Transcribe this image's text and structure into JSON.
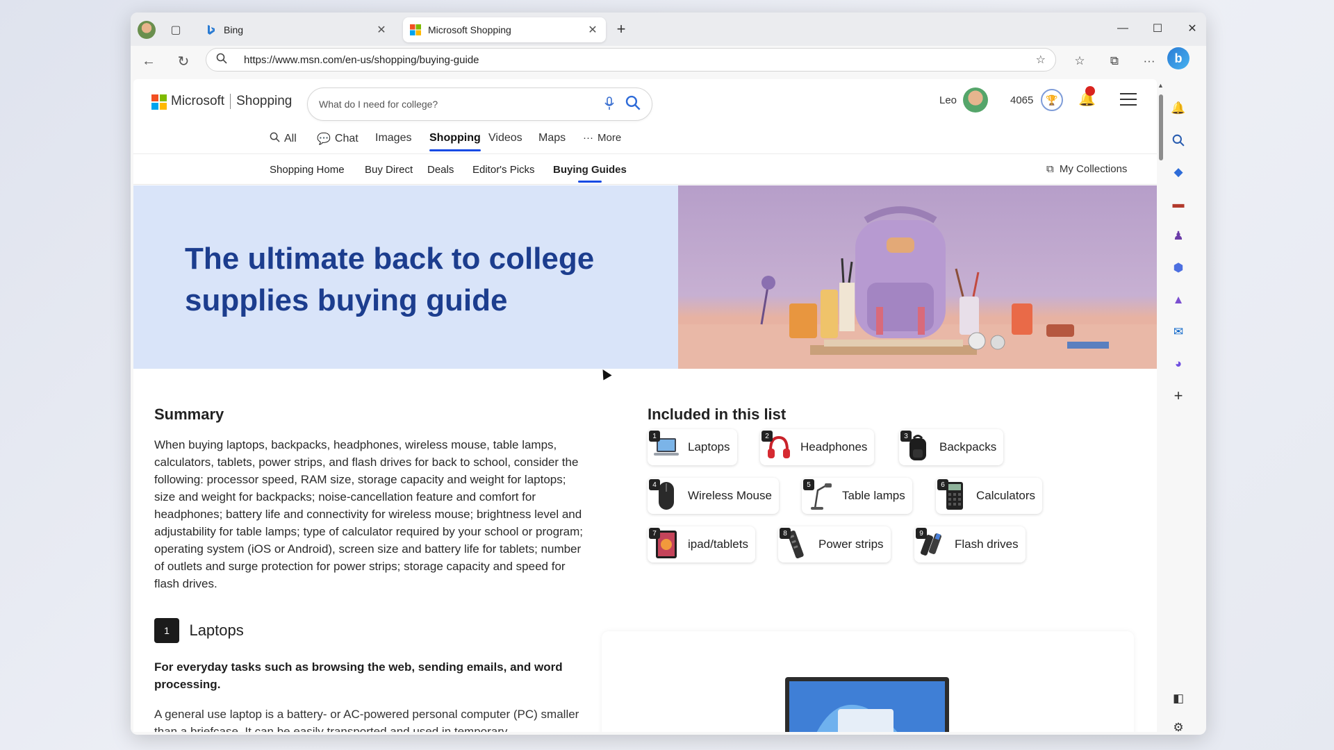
{
  "browser": {
    "tabs": [
      {
        "title": "Bing",
        "close": "✕"
      },
      {
        "title": "Microsoft Shopping",
        "close": "✕"
      }
    ],
    "new_tab": "+",
    "url": "https://www.msn.com/en-us/shopping/buying-guide",
    "window_controls": {
      "minimize": "—",
      "maximize": "☐",
      "close": "✕"
    },
    "copilot_label": "b"
  },
  "site": {
    "brand": "Microsoft",
    "section": "Shopping",
    "search_placeholder": "What do I need for college?",
    "user_name": "Leo",
    "points": "4065"
  },
  "scopes": [
    {
      "label": "All",
      "icon": "search-icon"
    },
    {
      "label": "Chat",
      "icon": "chat-icon"
    },
    {
      "label": "Images"
    },
    {
      "label": "Shopping",
      "active": true
    },
    {
      "label": "Videos"
    },
    {
      "label": "Maps"
    },
    {
      "label": "More",
      "icon": "more-icon"
    }
  ],
  "subnav": {
    "items": [
      "Shopping Home",
      "Buy Direct",
      "Deals",
      "Editor's Picks",
      "Buying Guides"
    ],
    "active": "Buying Guides",
    "collections": "My Collections"
  },
  "hero": {
    "title": "The ultimate back to college supplies buying guide"
  },
  "summary": {
    "heading": "Summary",
    "text": "When buying laptops, backpacks, headphones, wireless mouse, table lamps, calculators, tablets, power strips, and flash drives for back to school, consider the following: processor speed, RAM size, storage capacity and weight for laptops; size and weight for backpacks; noise-cancellation feature and comfort for headphones; battery life and connectivity for wireless mouse; brightness level and adjustability for table lamps; type of calculator required by your school or program; operating system (iOS or Android), screen size and battery life for tablets; number of outlets and surge protection for power strips; storage capacity and speed for flash drives."
  },
  "included": {
    "heading": "Included in this list",
    "items": [
      {
        "num": "1",
        "label": "Laptops"
      },
      {
        "num": "2",
        "label": "Headphones"
      },
      {
        "num": "3",
        "label": "Backpacks"
      },
      {
        "num": "4",
        "label": "Wireless Mouse"
      },
      {
        "num": "5",
        "label": "Table lamps"
      },
      {
        "num": "6",
        "label": "Calculators"
      },
      {
        "num": "7",
        "label": "ipad/tablets"
      },
      {
        "num": "8",
        "label": "Power strips"
      },
      {
        "num": "9",
        "label": "Flash drives"
      }
    ]
  },
  "laptops": {
    "num": "1",
    "title": "Laptops",
    "tagline": "For everyday tasks such as browsing the web, sending emails, and word processing.",
    "desc": "A general use laptop is a battery- or AC-powered personal computer (PC) smaller than a briefcase. It can be easily transported and used in temporary"
  },
  "colors": {
    "accent": "#174ae4",
    "hero_title": "#1c3d8e",
    "hero_bg": "#d9e4f9"
  }
}
